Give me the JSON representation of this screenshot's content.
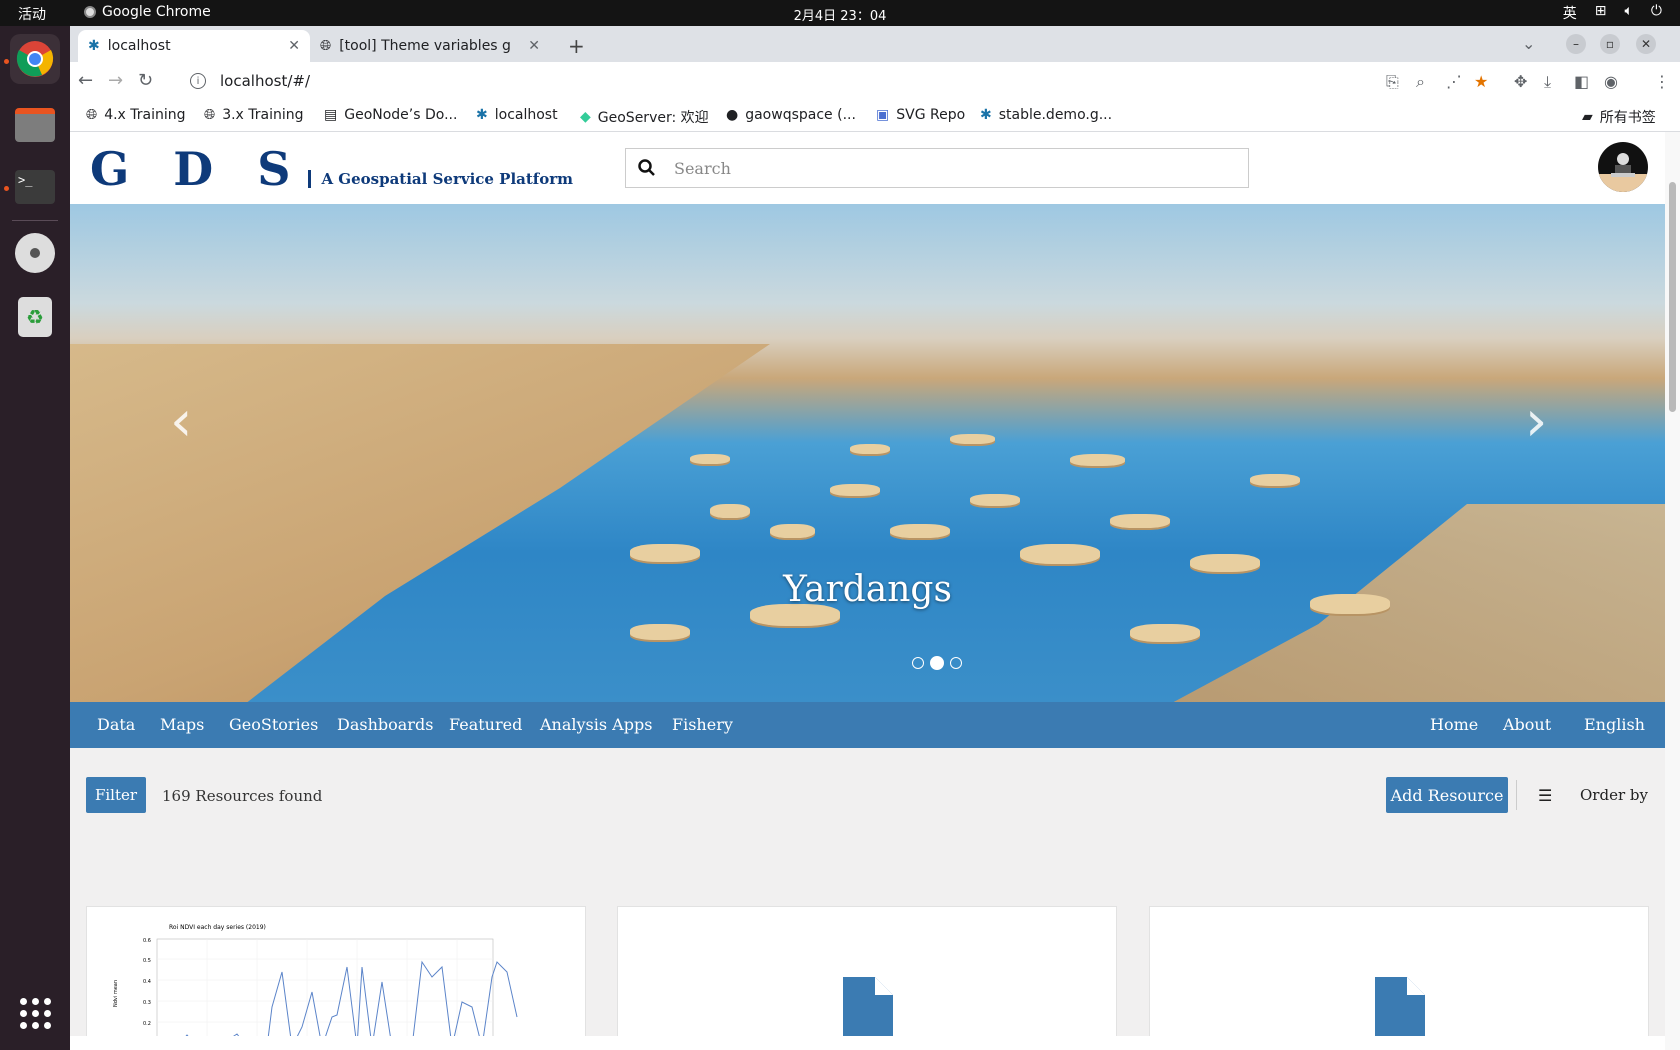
{
  "system": {
    "activities": "活动",
    "app_name": "Google Chrome",
    "clock": "2月4日 23：04",
    "input_method": "英"
  },
  "browser": {
    "tabs": [
      {
        "title": "localhost",
        "active": true
      },
      {
        "title": "[tool] Theme variables ge",
        "active": false
      }
    ],
    "url": "localhost/#/",
    "bookmarks": [
      {
        "label": "4.x Training",
        "icon": "globe-icon"
      },
      {
        "label": "3.x Training",
        "icon": "globe-icon"
      },
      {
        "label": "GeoNode’s Do...",
        "icon": "document-icon"
      },
      {
        "label": "localhost",
        "icon": "geonode-icon"
      },
      {
        "label": "GeoServer: 欢迎",
        "icon": "geoserver-icon"
      },
      {
        "label": "gaowqspace (...",
        "icon": "github-icon"
      },
      {
        "label": "SVG Repo",
        "icon": "svgrepo-icon"
      },
      {
        "label": "stable.demo.g...",
        "icon": "geonode-icon"
      }
    ],
    "bookmarks_folder": "所有书签"
  },
  "site": {
    "logo_letters": "G D S",
    "logo_tagline": "A Geospatial Service Platform",
    "search_placeholder": "Search",
    "hero_caption": "Yardangs",
    "carousel": {
      "slides": 3,
      "active": 2
    },
    "nav_left": [
      "Data",
      "Maps",
      "GeoStories",
      "Dashboards",
      "Featured",
      "Analysis Apps",
      "Fishery"
    ],
    "nav_right": [
      "Home",
      "About",
      "English"
    ],
    "filter_label": "Filter",
    "resources_found": "169 Resources found",
    "add_resource_label": "Add Resource",
    "order_by_label": "Order by",
    "cards": [
      {
        "type": "chart-thumbnail",
        "thumb_title": "Roi NDVI each day series (2019)",
        "thumb_ylabel": "Ndvi mean",
        "thumb_yticks": [
          "0.6",
          "0.5",
          "0.4",
          "0.3",
          "0.2"
        ]
      },
      {
        "type": "document",
        "icon": "file-icon"
      },
      {
        "type": "document",
        "icon": "file-icon"
      }
    ]
  },
  "colors": {
    "brand_navy": "#0e3a7a",
    "nav_blue": "#3b7bb2",
    "chrome_star": "#e37400"
  }
}
